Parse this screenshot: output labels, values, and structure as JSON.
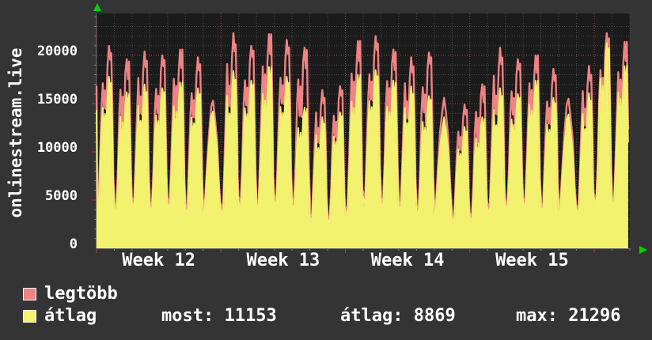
{
  "title": "onlinestream.live",
  "legend": {
    "series": [
      {
        "label": "legtöbb",
        "swatch_color": "#f08383"
      },
      {
        "label": "átlag",
        "swatch_color": "#f2f26e"
      }
    ],
    "stats": [
      {
        "text": "most: 11153"
      },
      {
        "text": "átlag: 8869"
      },
      {
        "text": "max: 21296"
      }
    ]
  },
  "colors": {
    "page_background": "#343434",
    "plot_background": "#1b1b1b",
    "minor_grid": "#4f4f4f",
    "major_grid": "#a64545",
    "axis_arrow": "#00d400",
    "text": "#ffffff",
    "legtobb": "#f08383",
    "atlag": "#f2f26e"
  },
  "chart_data": {
    "type": "area",
    "title": "onlinestream.live",
    "ylabel": "",
    "xlabel": "",
    "x_ticks": [
      "Week 12",
      "Week 13",
      "Week 14",
      "Week 15"
    ],
    "y_ticks": [
      0,
      5000,
      10000,
      15000,
      20000
    ],
    "y_minor_step": 1000,
    "ylim": [
      0,
      24350
    ],
    "days_shown": 30,
    "days_per_week": 7,
    "grid": true,
    "legend_position": "bottom-left",
    "series_meta": [
      {
        "name": "legtöbb",
        "style": "line",
        "color": "#f08383"
      },
      {
        "name": "átlag",
        "style": "area",
        "color": "#f2f26e"
      }
    ],
    "stats": {
      "most": 11153,
      "atlag": 8869,
      "max": 21296
    },
    "daily": [
      {
        "peak_legtobb": 21000,
        "peak_atlag": 17800,
        "low": 3800,
        "shape": "spiky"
      },
      {
        "peak_legtobb": 19600,
        "peak_atlag": 16200,
        "low": 3500,
        "shape": "spiky"
      },
      {
        "peak_legtobb": 20400,
        "peak_atlag": 17000,
        "low": 4000,
        "shape": "spiky"
      },
      {
        "peak_legtobb": 20000,
        "peak_atlag": 16600,
        "low": 3600,
        "shape": "spiky"
      },
      {
        "peak_legtobb": 20600,
        "peak_atlag": 17200,
        "low": 3900,
        "shape": "spiky"
      },
      {
        "peak_legtobb": 19800,
        "peak_atlag": 16600,
        "low": 3400,
        "shape": "spiky"
      },
      {
        "peak_legtobb": 15300,
        "peak_atlag": 14200,
        "low": 2900,
        "shape": "dome"
      },
      {
        "peak_legtobb": 22300,
        "peak_atlag": 18400,
        "low": 3200,
        "shape": "spiky"
      },
      {
        "peak_legtobb": 21000,
        "peak_atlag": 17400,
        "low": 4000,
        "shape": "spiky"
      },
      {
        "peak_legtobb": 22200,
        "peak_atlag": 18800,
        "low": 3800,
        "shape": "spiky"
      },
      {
        "peak_legtobb": 21600,
        "peak_atlag": 17800,
        "low": 4200,
        "shape": "spiky"
      },
      {
        "peak_legtobb": 20800,
        "peak_atlag": 14600,
        "low": 4000,
        "shape": "spiky"
      },
      {
        "peak_legtobb": 16400,
        "peak_atlag": 13600,
        "low": 2600,
        "shape": "spiky"
      },
      {
        "peak_legtobb": 16800,
        "peak_atlag": 14100,
        "low": 2400,
        "shape": "spiky"
      },
      {
        "peak_legtobb": 21500,
        "peak_atlag": 18000,
        "low": 3000,
        "shape": "spiky"
      },
      {
        "peak_legtobb": 22000,
        "peak_atlag": 18500,
        "low": 4500,
        "shape": "spiky"
      },
      {
        "peak_legtobb": 20600,
        "peak_atlag": 17400,
        "low": 4000,
        "shape": "spiky"
      },
      {
        "peak_legtobb": 19800,
        "peak_atlag": 16800,
        "low": 3700,
        "shape": "spiky"
      },
      {
        "peak_legtobb": 20300,
        "peak_atlag": 15800,
        "low": 3300,
        "shape": "spiky"
      },
      {
        "peak_legtobb": 15600,
        "peak_atlag": 13600,
        "low": 2700,
        "shape": "dome"
      },
      {
        "peak_legtobb": 14900,
        "peak_atlag": 12600,
        "low": 2500,
        "shape": "spiky"
      },
      {
        "peak_legtobb": 17000,
        "peak_atlag": 13600,
        "low": 2600,
        "shape": "spiky"
      },
      {
        "peak_legtobb": 20800,
        "peak_atlag": 16600,
        "low": 3400,
        "shape": "spiky"
      },
      {
        "peak_legtobb": 19600,
        "peak_atlag": 16000,
        "low": 3800,
        "shape": "spiky"
      },
      {
        "peak_legtobb": 20000,
        "peak_atlag": 17400,
        "low": 4000,
        "shape": "spiky"
      },
      {
        "peak_legtobb": 18600,
        "peak_atlag": 15600,
        "low": 3600,
        "shape": "spiky"
      },
      {
        "peak_legtobb": 15500,
        "peak_atlag": 13900,
        "low": 2900,
        "shape": "dome"
      },
      {
        "peak_legtobb": 18900,
        "peak_atlag": 16100,
        "low": 3300,
        "shape": "spiky"
      },
      {
        "peak_legtobb": 22300,
        "peak_atlag": 21296,
        "low": 4200,
        "shape": "spiky"
      },
      {
        "peak_legtobb": 21400,
        "peak_atlag": 18900,
        "low": 4100,
        "shape": "spiky"
      }
    ],
    "profiles": {
      "spiky": {
        "t": [
          0,
          0.05,
          0.12,
          0.2,
          0.28,
          0.35,
          0.42,
          0.48,
          0.54,
          0.62,
          0.7,
          0.77,
          0.83,
          0.89,
          0.94,
          1.0
        ],
        "f": [
          0.06,
          0.02,
          0.05,
          0.3,
          0.62,
          0.8,
          0.6,
          0.74,
          0.58,
          0.88,
          1.0,
          0.9,
          0.97,
          0.6,
          0.22,
          0.06
        ]
      },
      "dome": {
        "t": [
          0,
          0.08,
          0.2,
          0.32,
          0.45,
          0.55,
          0.65,
          0.78,
          0.9,
          1.0
        ],
        "f": [
          0.06,
          0.12,
          0.4,
          0.72,
          0.92,
          1.0,
          0.9,
          0.65,
          0.28,
          0.06
        ]
      }
    },
    "start_frac": 0.75,
    "end_day_fraction": 0.906
  }
}
